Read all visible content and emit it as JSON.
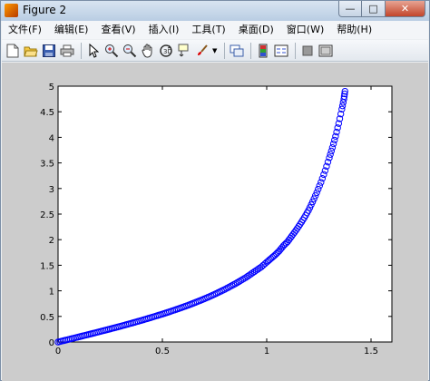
{
  "window": {
    "title": "Figure 2",
    "controls": {
      "minimize": "—",
      "maximize": "□",
      "close": "✕"
    }
  },
  "menu": {
    "items": [
      {
        "id": "file",
        "label": "文件(F)"
      },
      {
        "id": "edit",
        "label": "编辑(E)"
      },
      {
        "id": "view",
        "label": "查看(V)"
      },
      {
        "id": "insert",
        "label": "插入(I)"
      },
      {
        "id": "tools",
        "label": "工具(T)"
      },
      {
        "id": "desktop",
        "label": "桌面(D)"
      },
      {
        "id": "window",
        "label": "窗口(W)"
      },
      {
        "id": "help",
        "label": "帮助(H)"
      }
    ]
  },
  "toolbar": {
    "icons": [
      "new-figure-icon",
      "open-file-icon",
      "save-icon",
      "print-icon",
      "pointer-icon",
      "zoom-in-icon",
      "zoom-out-icon",
      "pan-hand-icon",
      "rotate-3d-icon",
      "data-cursor-icon",
      "brush-icon",
      "link-plot-icon",
      "colorbar-icon",
      "legend-icon",
      "hide-plot-tools-icon",
      "show-plot-tools-icon"
    ]
  },
  "colors": {
    "marker": "#0000ff",
    "axes_background": "#ffffff",
    "figure_background": "#cccccc"
  },
  "chart_data": {
    "type": "scatter",
    "title": "",
    "xlabel": "",
    "ylabel": "",
    "xlim": [
      0,
      1.6
    ],
    "ylim": [
      0,
      5
    ],
    "xticks": [
      "0",
      "0.5",
      "1",
      "1.5"
    ],
    "yticks": [
      "0",
      "0.5",
      "1",
      "1.5",
      "2",
      "2.5",
      "3",
      "3.5",
      "4",
      "4.5",
      "5"
    ],
    "xtick_values": [
      0,
      0.5,
      1,
      1.5
    ],
    "ytick_values": [
      0,
      0.5,
      1,
      1.5,
      2,
      2.5,
      3,
      3.5,
      4,
      4.5,
      5
    ],
    "grid": false,
    "marker": "o",
    "series": [
      {
        "x": [
          0,
          0.025,
          0.05,
          0.075,
          0.1,
          0.125,
          0.15,
          0.175,
          0.2,
          0.225,
          0.25,
          0.275,
          0.3,
          0.325,
          0.35,
          0.375,
          0.4,
          0.425,
          0.45,
          0.475,
          0.5,
          0.525,
          0.55,
          0.575,
          0.6,
          0.625,
          0.65,
          0.675,
          0.7,
          0.725,
          0.75,
          0.775,
          0.8,
          0.825,
          0.85,
          0.875,
          0.9,
          0.925,
          0.95,
          0.975,
          1,
          1.02,
          1.04,
          1.06,
          1.08,
          1.1,
          1.12,
          1.14,
          1.16,
          1.18,
          1.2,
          1.22,
          1.24,
          1.26,
          1.28,
          1.3,
          1.315,
          1.33,
          1.345,
          1.36,
          1.37,
          1.375
        ],
        "y": [
          0,
          0.025,
          0.05,
          0.075,
          0.1,
          0.126,
          0.151,
          0.177,
          0.203,
          0.229,
          0.255,
          0.282,
          0.309,
          0.337,
          0.365,
          0.394,
          0.423,
          0.453,
          0.483,
          0.515,
          0.546,
          0.579,
          0.613,
          0.648,
          0.684,
          0.721,
          0.76,
          0.8,
          0.842,
          0.886,
          0.932,
          0.981,
          1.03,
          1.085,
          1.14,
          1.2,
          1.26,
          1.33,
          1.4,
          1.47,
          1.56,
          1.63,
          1.7,
          1.78,
          1.88,
          1.96,
          2.07,
          2.18,
          2.3,
          2.43,
          2.57,
          2.74,
          2.92,
          3.12,
          3.35,
          3.6,
          3.8,
          4.02,
          4.27,
          4.55,
          4.75,
          4.9
        ]
      }
    ]
  }
}
